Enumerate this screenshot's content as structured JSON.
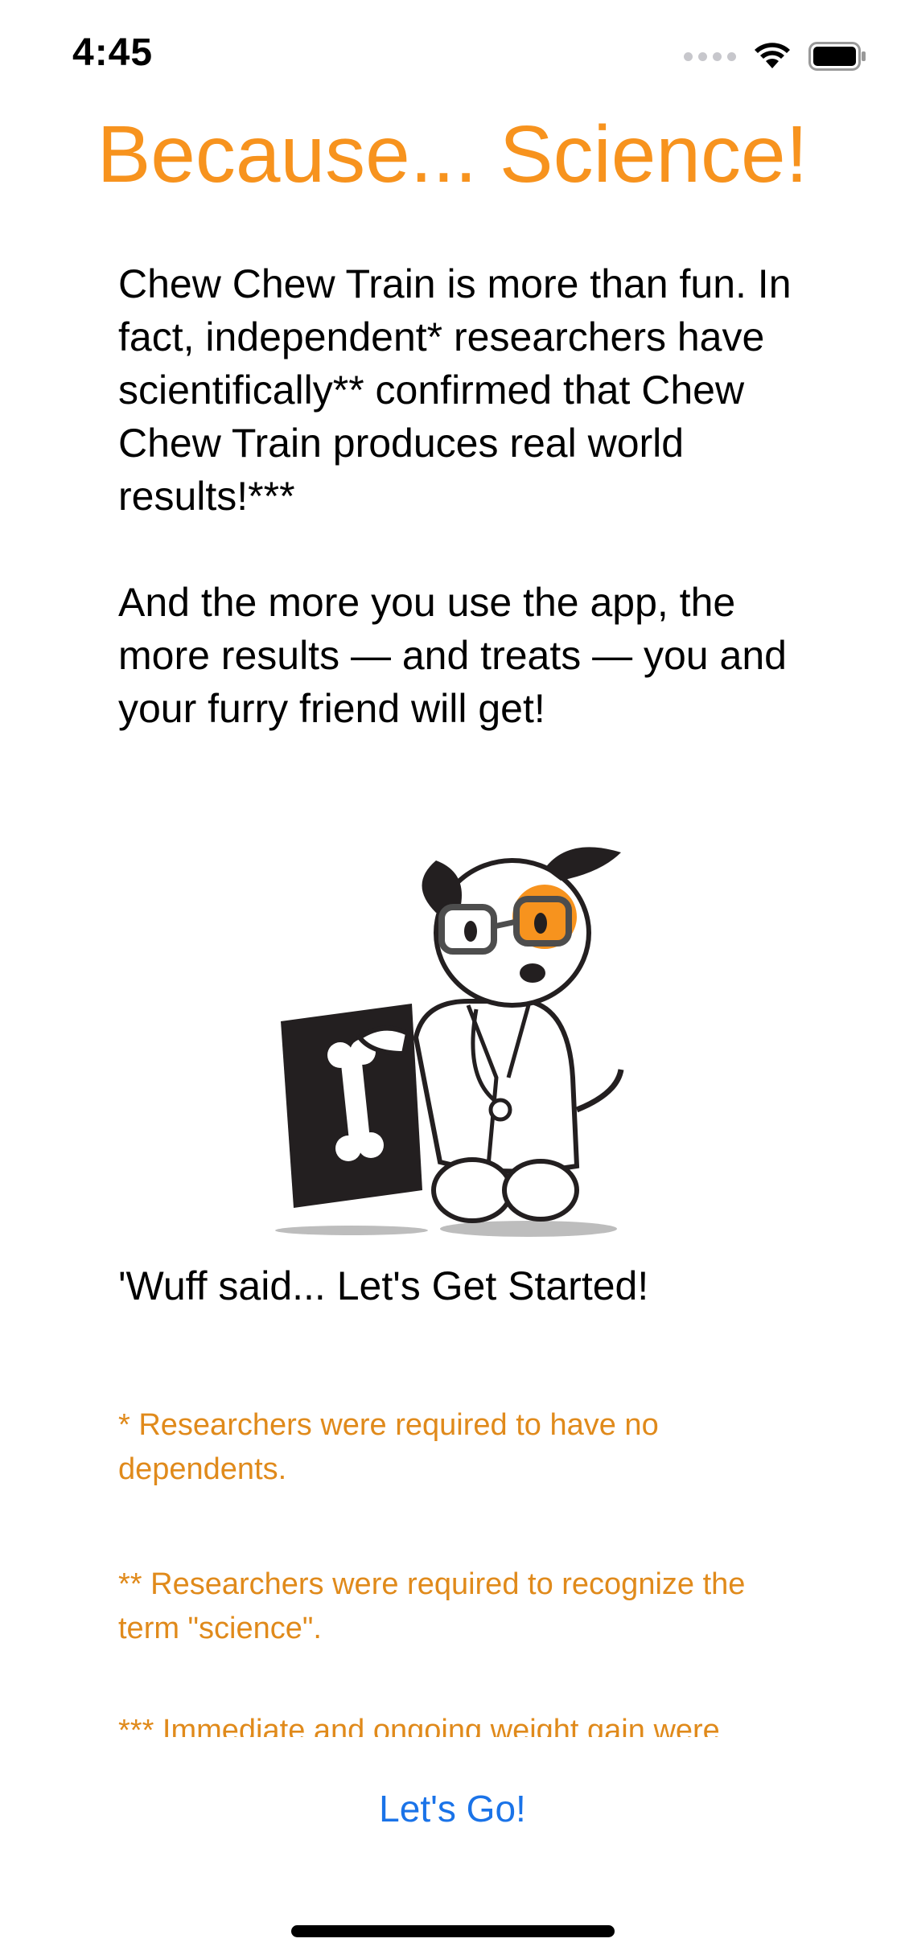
{
  "status_bar": {
    "time": "4:45",
    "icons": [
      "signal-dots-icon",
      "wifi-icon",
      "battery-icon"
    ]
  },
  "title": "Because... Science!",
  "intro": {
    "paragraph_1": "Chew Chew Train is more than fun. In fact, independent* researchers have scientifically** confirmed that Chew Chew Train produces real world results!***",
    "paragraph_2": "And the more you use the app, the more results — and treats — you and your furry friend will get!"
  },
  "illustration": {
    "icon": "scientist-dog-icon",
    "accent_color": "#f7931e"
  },
  "tagline": "'Wuff said... Let's Get Started!",
  "footnotes": [
    "* Researchers were required to have no dependents.",
    "** Researchers were required to recognize the term \"science\".",
    "*** Immediate and ongoing weight gain were"
  ],
  "button": {
    "label": "Let's Go!"
  },
  "colors": {
    "title": "#f7931e",
    "footnote": "#e08a1b",
    "button": "#1a73e8"
  }
}
